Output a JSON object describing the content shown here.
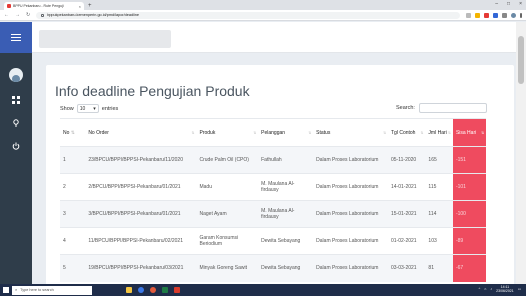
{
  "browser": {
    "tab_title": "BPPU Pekanbaru - Rute Penguji",
    "tab_close": "×",
    "new_tab": "+",
    "url": "bppukpekanbaru.kemenperin.go.id/pmd/lapor/deadline",
    "window_controls": [
      "–",
      "□",
      "×"
    ]
  },
  "header": {
    "title": "Info deadline Pengujian Produk"
  },
  "table_controls": {
    "show_label": "Show",
    "entries_value": "10",
    "entries_label": "entries",
    "search_label": "Search:"
  },
  "table": {
    "columns": [
      "No",
      "No Order",
      "Produk",
      "Pelanggan",
      "Status",
      "Tgl Contoh",
      "Jml Hari",
      "Sisa Hari"
    ],
    "rows": [
      [
        "1",
        "23/BPCU/BPPI/BPPSI-Pekanbaru/11/2020",
        "Crude Palm Oil (CPO)",
        "Fathullah",
        "Dalam Proses Laboratorium",
        "05-11-2020",
        "165",
        "-151"
      ],
      [
        "2",
        "2/BPCU/BPPI/BPPSI-Pekanbaru/01/2021",
        "Madu",
        "M. Maulana Al-firdausy",
        "Dalam Proses Laboratorium",
        "14-01-2021",
        "115",
        "-101"
      ],
      [
        "3",
        "3/BPCU/BPPI/BPPSI-Pekanbaru/01/2021",
        "Naget Ayam",
        "M. Maulana Al-firdausy",
        "Dalam Proses Laboratorium",
        "15-01-2021",
        "114",
        "-100"
      ],
      [
        "4",
        "11/BPCU/BPPI/BPPSI-Pekanbaru/02/2021",
        "Garam Konsumsi Beriodium",
        "Dewita Sebayang",
        "Dalam Proses Laboratorium",
        "01-02-2021",
        "103",
        "-89"
      ],
      [
        "5",
        "19/BPCU/BPPI/BPPSI-Pekanbaru/03/2021",
        "Minyak Goreng Sawit",
        "Dewita Sebayang",
        "Dalam Proses Laboratorium",
        "03-03-2021",
        "81",
        "-67"
      ]
    ]
  },
  "taskbar": {
    "search_placeholder": "Type here to search",
    "time": "14:11",
    "date": "23/06/2021"
  },
  "colors": {
    "sidebar": "#2f3d4a",
    "sidebar_top": "#3a5db4",
    "overdue": "#ef4b5f"
  }
}
